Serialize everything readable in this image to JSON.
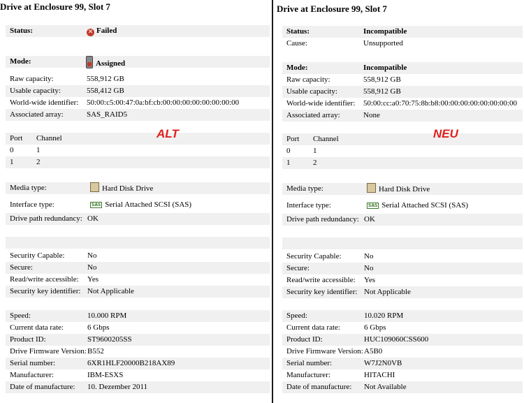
{
  "left": {
    "title": "Drive at Enclosure 99, Slot 7",
    "watermark": "ALT",
    "status_label": "Status:",
    "status_value": "Failed",
    "mode_label": "Mode:",
    "mode_value": "Assigned",
    "raw_label": "Raw capacity:",
    "raw_value": "558,912 GB",
    "usable_label": "Usable capacity:",
    "usable_value": "558,412 GB",
    "wwid_label": "World-wide identifier:",
    "wwid_value": "50:00:c5:00:47:0a:bf:cb:00:00:00:00:00:00:00:00",
    "array_label": "Associated array:",
    "array_value": "SAS_RAID5",
    "port_header": "Port",
    "channel_header": "Channel",
    "ports": [
      {
        "port": "0",
        "channel": "1"
      },
      {
        "port": "1",
        "channel": "2"
      }
    ],
    "media_label": "Media type:",
    "media_value": "Hard Disk Drive",
    "iface_label": "Interface type:",
    "iface_icon_text": "SAS",
    "iface_value": "Serial Attached SCSI (SAS)",
    "redund_label": "Drive path redundancy:",
    "redund_value": "OK",
    "sec_cap_label": "Security Capable:",
    "sec_cap_value": "No",
    "secure_label": "Secure:",
    "secure_value": "No",
    "rw_label": "Read/write accessible:",
    "rw_value": "Yes",
    "key_label": "Security key identifier:",
    "key_value": "Not Applicable",
    "speed_label": "Speed:",
    "speed_value": "10.000 RPM",
    "rate_label": "Current data rate:",
    "rate_value": "6 Gbps",
    "product_label": "Product ID:",
    "product_value": "ST9600205SS",
    "fw_label": "Drive Firmware Version:",
    "fw_value": "B552",
    "serial_label": "Serial number:",
    "serial_value": "6XR1HLF20000B218AX89",
    "mfr_label": "Manufacturer:",
    "mfr_value": "IBM-ESXS",
    "date_label": "Date of manufacture:",
    "date_value": "10. Dezember 2011"
  },
  "right": {
    "title": "Drive at Enclosure 99, Slot 7",
    "watermark": "NEU",
    "status_label": "Status:",
    "status_value": "Incompatible",
    "cause_label": "Cause:",
    "cause_value": "Unsupported",
    "mode_label": "Mode:",
    "mode_value": "Incompatible",
    "raw_label": "Raw capacity:",
    "raw_value": "558,912 GB",
    "usable_label": "Usable capacity:",
    "usable_value": "558,912 GB",
    "wwid_label": "World-wide identifier:",
    "wwid_value": "50:00:cc:a0:70:75:8b:b8:00:00:00:00:00:00:00:00",
    "array_label": "Associated array:",
    "array_value": "None",
    "port_header": "Port",
    "channel_header": "Channel",
    "ports": [
      {
        "port": "0",
        "channel": "1"
      },
      {
        "port": "1",
        "channel": "2"
      }
    ],
    "media_label": "Media type:",
    "media_value": "Hard Disk Drive",
    "iface_label": "Interface type:",
    "iface_icon_text": "SAS",
    "iface_value": "Serial Attached SCSI (SAS)",
    "redund_label": "Drive path redundancy:",
    "redund_value": "OK",
    "sec_cap_label": "Security Capable:",
    "sec_cap_value": "No",
    "secure_label": "Secure:",
    "secure_value": "No",
    "rw_label": "Read/write accessible:",
    "rw_value": "Yes",
    "key_label": "Security key identifier:",
    "key_value": "Not Applicable",
    "speed_label": "Speed:",
    "speed_value": "10.020 RPM",
    "rate_label": "Current data rate:",
    "rate_value": "6 Gbps",
    "product_label": "Product ID:",
    "product_value": "HUC109060CSS600",
    "fw_label": "Drive Firmware Version:",
    "fw_value": "A5B0",
    "serial_label": "Serial number:",
    "serial_value": "W7J2N0VB",
    "mfr_label": "Manufacturer:",
    "mfr_value": "HITACHI",
    "date_label": "Date of manufacture:",
    "date_value": "Not Available"
  }
}
